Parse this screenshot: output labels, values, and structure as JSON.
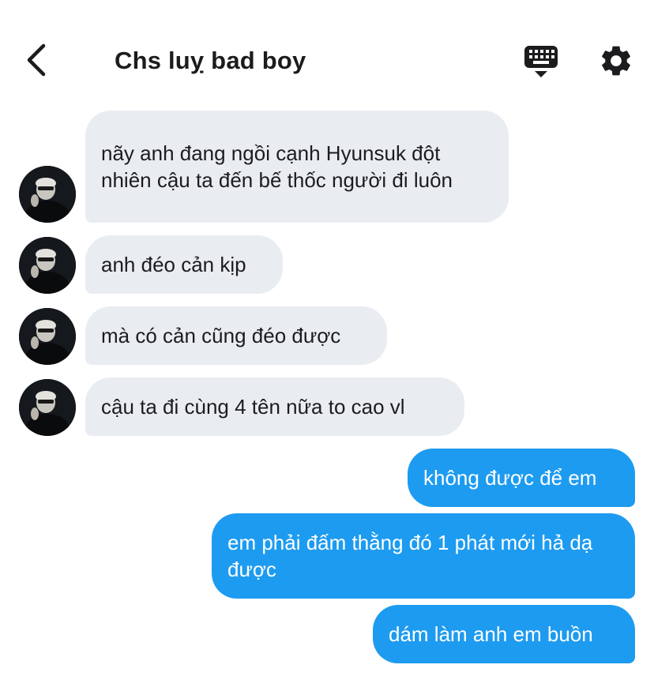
{
  "header": {
    "title": "Chs luỵ bad boy",
    "back_icon": "chevron-left-icon",
    "keyboard_icon": "keyboard-icon",
    "settings_icon": "gear-icon"
  },
  "messages": [
    {
      "direction": "incoming",
      "text": "nãy anh đang ngồi cạnh Hyunsuk đột nhiên cậu ta đến bế thốc người đi luôn"
    },
    {
      "direction": "incoming",
      "text": "anh đéo cản kịp"
    },
    {
      "direction": "incoming",
      "text": "mà có cản cũng đéo được"
    },
    {
      "direction": "incoming",
      "text": "cậu ta đi cùng 4 tên nữa to cao vl"
    },
    {
      "direction": "outgoing",
      "text": "không được để em"
    },
    {
      "direction": "outgoing",
      "text": "em phải đấm thằng đó 1 phát mới hả dạ được"
    },
    {
      "direction": "outgoing",
      "text": "dám làm anh em buồn"
    }
  ],
  "colors": {
    "incoming_bubble": "#e9edf2",
    "outgoing_bubble": "#1d9bf0",
    "text_dark": "#1c1c1e"
  }
}
